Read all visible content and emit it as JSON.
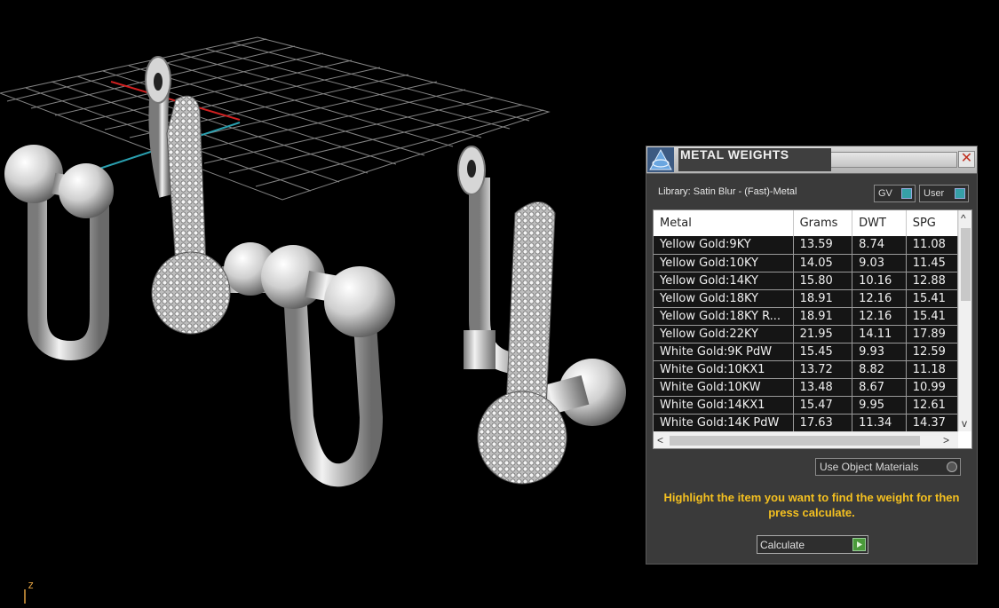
{
  "viewport": {
    "axis_z_label": "z"
  },
  "panel": {
    "title": "METAL WEIGHTS",
    "close_glyph": "✕",
    "library_label": "Library: Satin Blur - (Fast)-Metal",
    "gv_label": "GV",
    "user_label": "User",
    "use_object_materials_label": "Use Object Materials",
    "instruction": "Highlight the item you want to find the weight for then press calculate.",
    "calculate_label": "Calculate",
    "icons": [
      "logo-icon",
      "close-icon",
      "scroll-up-icon",
      "scroll-down-icon",
      "scroll-left-icon",
      "scroll-right-icon",
      "play-icon"
    ]
  },
  "table": {
    "headers": [
      "Metal",
      "Grams",
      "DWT",
      "SPG"
    ],
    "rows": [
      [
        "Yellow Gold:9KY",
        "13.59",
        "8.74",
        "11.08"
      ],
      [
        "Yellow Gold:10KY",
        "14.05",
        "9.03",
        "11.45"
      ],
      [
        "Yellow Gold:14KY",
        "15.80",
        "10.16",
        "12.88"
      ],
      [
        "Yellow Gold:18KY",
        "18.91",
        "12.16",
        "15.41"
      ],
      [
        "Yellow Gold:18KY R...",
        "18.91",
        "12.16",
        "15.41"
      ],
      [
        "Yellow Gold:22KY",
        "21.95",
        "14.11",
        "17.89"
      ],
      [
        "White Gold:9K PdW",
        "15.45",
        "9.93",
        "12.59"
      ],
      [
        "White Gold:10KX1",
        "13.72",
        "8.82",
        "11.18"
      ],
      [
        "White Gold:10KW",
        "13.48",
        "8.67",
        "10.99"
      ],
      [
        "White Gold:14KX1",
        "15.47",
        "9.95",
        "12.61"
      ],
      [
        "White Gold:14K PdW",
        "17.63",
        "11.34",
        "14.37"
      ]
    ]
  }
}
